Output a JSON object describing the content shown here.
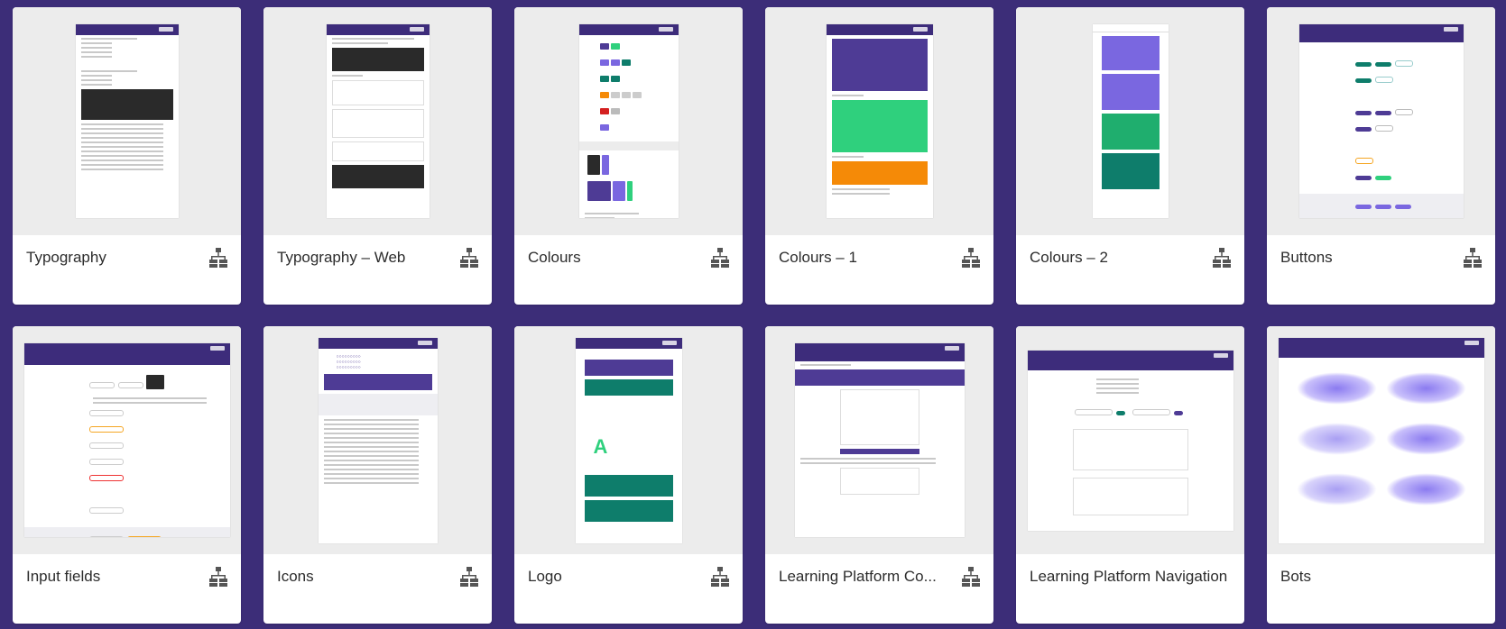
{
  "cards": [
    {
      "label": "Typography",
      "has_symbol_icon": true
    },
    {
      "label": "Typography – Web",
      "has_symbol_icon": true
    },
    {
      "label": "Colours",
      "has_symbol_icon": true
    },
    {
      "label": "Colours – 1",
      "has_symbol_icon": true
    },
    {
      "label": "Colours – 2",
      "has_symbol_icon": true
    },
    {
      "label": "Buttons",
      "has_symbol_icon": true
    },
    {
      "label": "Input fields",
      "has_symbol_icon": true
    },
    {
      "label": "Icons",
      "has_symbol_icon": true
    },
    {
      "label": "Logo",
      "has_symbol_icon": true
    },
    {
      "label": "Learning Platform Co...",
      "has_symbol_icon": true
    },
    {
      "label": "Learning Platform Navigation",
      "has_symbol_icon": false
    },
    {
      "label": "Bots",
      "has_symbol_icon": false
    }
  ],
  "icon_names": {
    "symbol": "component-hierarchy-icon"
  },
  "colors": {
    "background": "#3c2d78",
    "card": "#ffffff",
    "thumb_bg": "#ececec",
    "brand_purple": "#3d2c7b"
  }
}
